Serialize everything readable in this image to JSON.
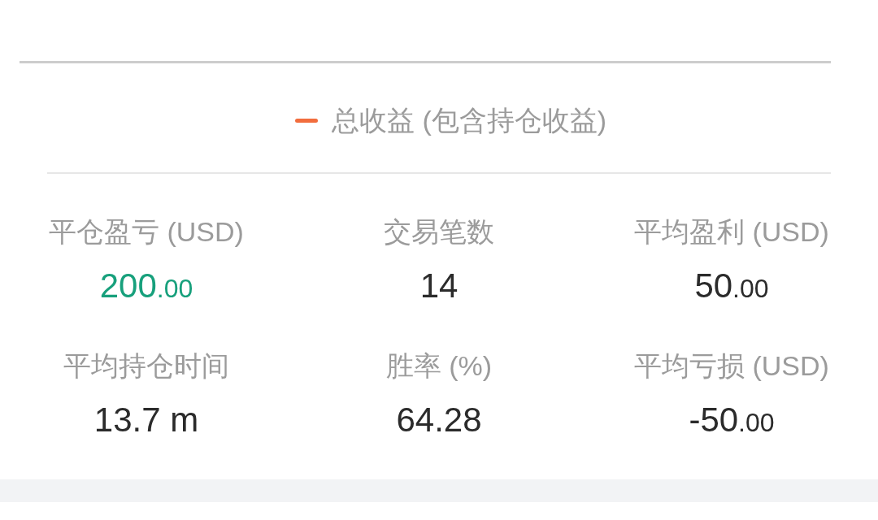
{
  "legend": [
    {
      "label": "总收益 (包含持仓收益)",
      "color": "#f26d3d"
    }
  ],
  "stats": [
    {
      "label": "平仓盈亏 (USD)",
      "value": "200",
      "fraction": ".00",
      "color": "#17a07c"
    },
    {
      "label": "交易笔数",
      "value": "14",
      "color": "#2b2b2b"
    },
    {
      "label": "平均盈利 (USD)",
      "value": "50",
      "fraction": ".00",
      "color": "#2b2b2b"
    },
    {
      "label": "平均持仓时间",
      "value": "13.7 m",
      "color": "#2b2b2b"
    },
    {
      "label": "胜率 (%)",
      "value": "64.28",
      "color": "#2b2b2b"
    },
    {
      "label": "平均亏损 (USD)",
      "value": "-50",
      "fraction": ".00",
      "color": "#2b2b2b"
    }
  ]
}
